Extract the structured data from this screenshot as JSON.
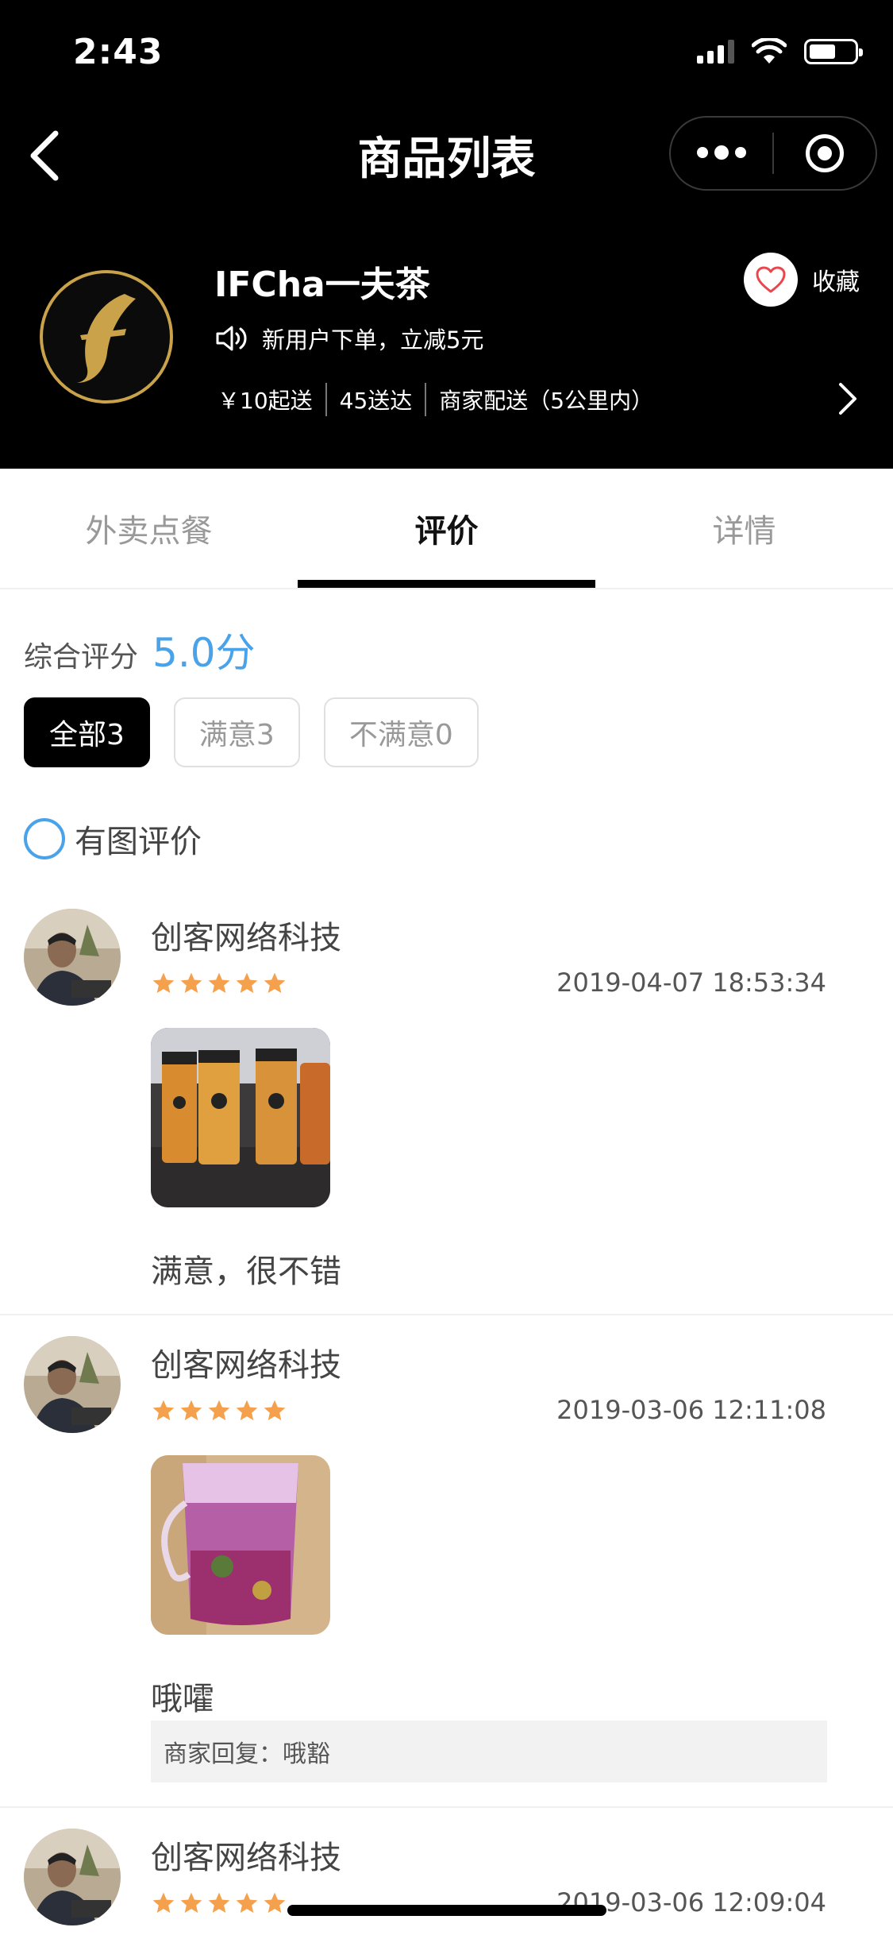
{
  "status_bar": {
    "time": "2:43"
  },
  "nav": {
    "title": "商品列表"
  },
  "shop": {
    "name": "IFCha一夫茶",
    "promo": "新用户下单，立减5元",
    "min_order": "￥10起送",
    "delivery_time": "45送达",
    "delivery_mode": "商家配送（5公里内）",
    "favorite_label": "收藏"
  },
  "tabs": [
    {
      "label": "外卖点餐"
    },
    {
      "label": "评价"
    },
    {
      "label": "详情"
    }
  ],
  "rating": {
    "label": "综合评分",
    "score": "5.0分",
    "filters": [
      {
        "label": "全部3"
      },
      {
        "label": "满意3"
      },
      {
        "label": "不满意0"
      }
    ],
    "with_pictures_label": "有图评价"
  },
  "reviews": [
    {
      "user": "创客网络科技",
      "stars": 5,
      "time": "2019-04-07 18:53:34",
      "text": "满意，很不错",
      "reply": ""
    },
    {
      "user": "创客网络科技",
      "stars": 5,
      "time": "2019-03-06 12:11:08",
      "text": "哦嚯",
      "reply": "商家回复：哦豁"
    },
    {
      "user": "创客网络科技",
      "stars": 5,
      "time": "2019-03-06 12:09:04",
      "text": "",
      "reply": ""
    }
  ],
  "colors": {
    "accent_blue": "#4aa3e9",
    "star_orange": "#f5a04c",
    "header_black": "#000000",
    "logo_gold": "#c9a24a",
    "heart_red": "#e8474d"
  }
}
